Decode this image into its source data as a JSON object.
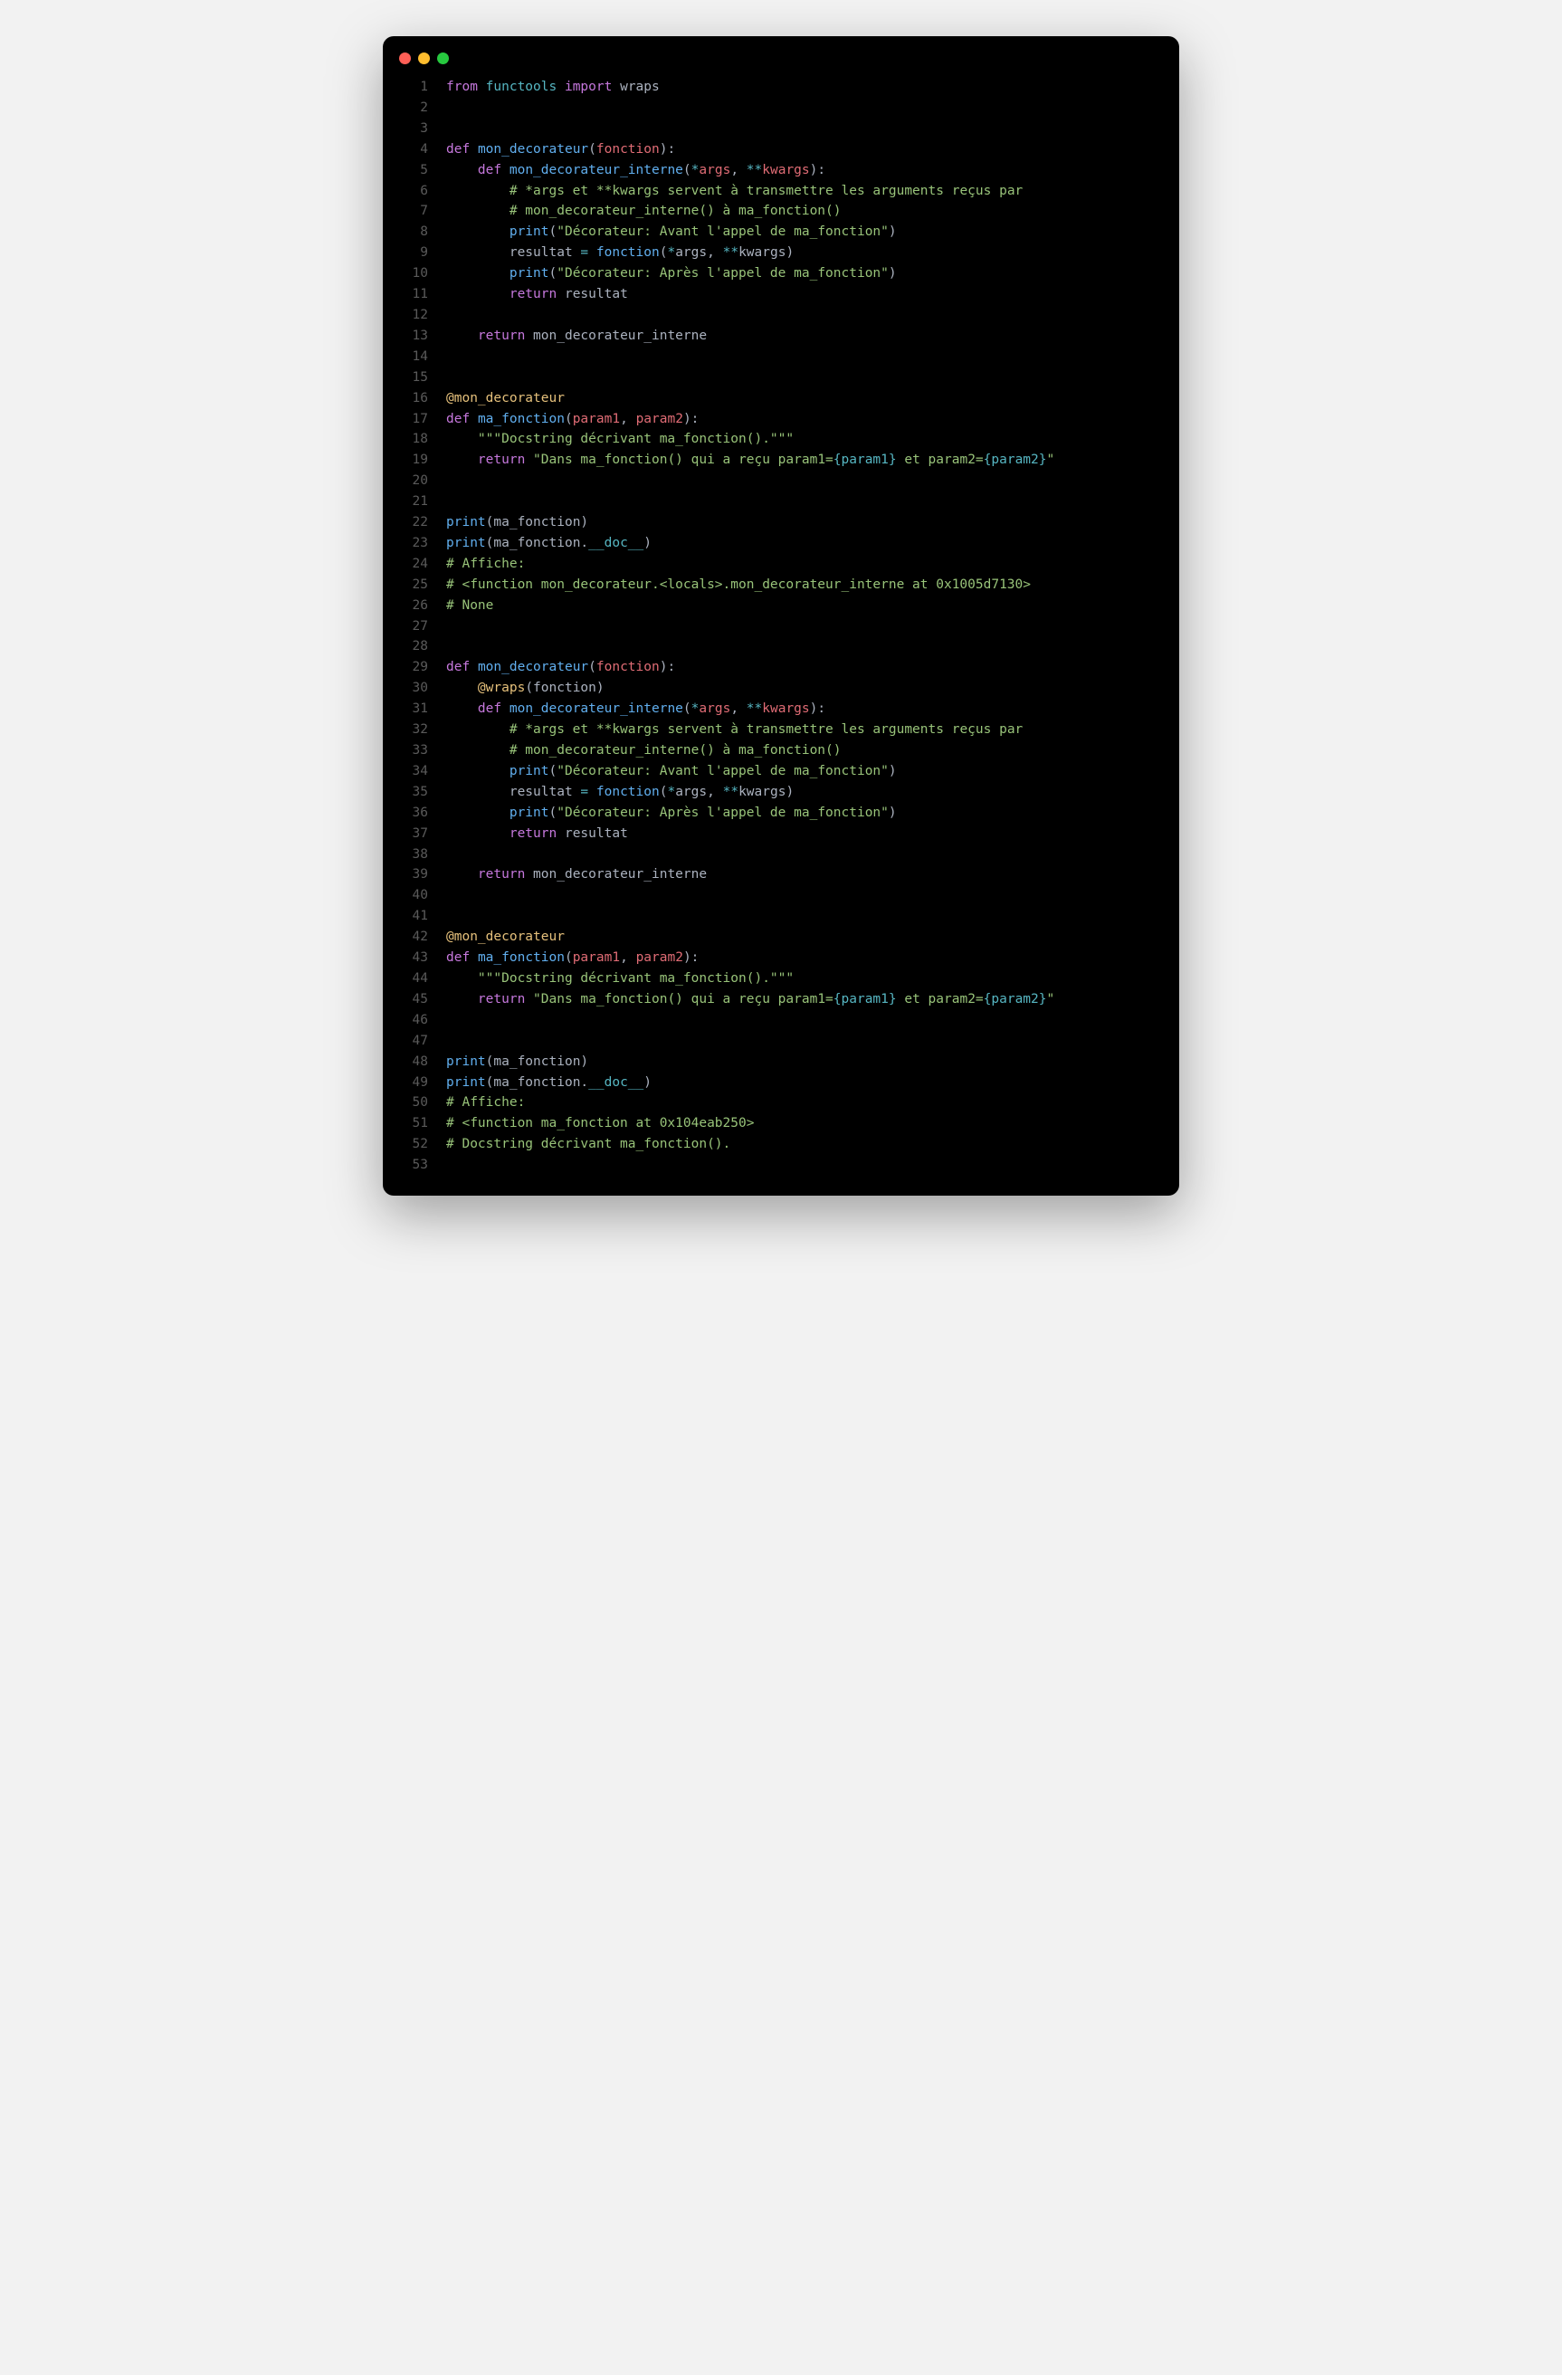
{
  "lines": [
    [
      [
        "kw",
        "from"
      ],
      [
        "p",
        " "
      ],
      [
        "mod",
        "functools"
      ],
      [
        "p",
        " "
      ],
      [
        "kw",
        "import"
      ],
      [
        "p",
        " "
      ],
      [
        "n",
        "wraps"
      ]
    ],
    [],
    [],
    [
      [
        "kw",
        "def"
      ],
      [
        "p",
        " "
      ],
      [
        "fn",
        "mon_decorateur"
      ],
      [
        "p",
        "("
      ],
      [
        "pr",
        "fonction"
      ],
      [
        "p",
        "):"
      ]
    ],
    [
      [
        "p",
        "    "
      ],
      [
        "kw",
        "def"
      ],
      [
        "p",
        " "
      ],
      [
        "fn",
        "mon_decorateur_interne"
      ],
      [
        "p",
        "("
      ],
      [
        "op",
        "*"
      ],
      [
        "pr",
        "args"
      ],
      [
        "p",
        ", "
      ],
      [
        "op",
        "**"
      ],
      [
        "pr",
        "kwargs"
      ],
      [
        "p",
        "):"
      ]
    ],
    [
      [
        "p",
        "        "
      ],
      [
        "cmt",
        "# *args et **kwargs servent à transmettre les arguments reçus par"
      ]
    ],
    [
      [
        "p",
        "        "
      ],
      [
        "cmt",
        "# mon_decorateur_interne() à ma_fonction()"
      ]
    ],
    [
      [
        "p",
        "        "
      ],
      [
        "fn",
        "print"
      ],
      [
        "p",
        "("
      ],
      [
        "s",
        "\"Décorateur: Avant l'appel de ma_fonction\""
      ],
      [
        "p",
        ")"
      ]
    ],
    [
      [
        "p",
        "        "
      ],
      [
        "n",
        "resultat "
      ],
      [
        "op",
        "="
      ],
      [
        "p",
        " "
      ],
      [
        "fn",
        "fonction"
      ],
      [
        "p",
        "("
      ],
      [
        "op",
        "*"
      ],
      [
        "n",
        "args"
      ],
      [
        "p",
        ", "
      ],
      [
        "op",
        "**"
      ],
      [
        "n",
        "kwargs"
      ],
      [
        "p",
        ")"
      ]
    ],
    [
      [
        "p",
        "        "
      ],
      [
        "fn",
        "print"
      ],
      [
        "p",
        "("
      ],
      [
        "s",
        "\"Décorateur: Après l'appel de ma_fonction\""
      ],
      [
        "p",
        ")"
      ]
    ],
    [
      [
        "p",
        "        "
      ],
      [
        "kw",
        "return"
      ],
      [
        "p",
        " "
      ],
      [
        "n",
        "resultat"
      ]
    ],
    [],
    [
      [
        "p",
        "    "
      ],
      [
        "kw",
        "return"
      ],
      [
        "p",
        " "
      ],
      [
        "n",
        "mon_decorateur_interne"
      ]
    ],
    [],
    [],
    [
      [
        "dec",
        "@mon_decorateur"
      ]
    ],
    [
      [
        "kw",
        "def"
      ],
      [
        "p",
        " "
      ],
      [
        "fn",
        "ma_fonction"
      ],
      [
        "p",
        "("
      ],
      [
        "pr",
        "param1"
      ],
      [
        "p",
        ", "
      ],
      [
        "pr",
        "param2"
      ],
      [
        "p",
        "):"
      ]
    ],
    [
      [
        "p",
        "    "
      ],
      [
        "s",
        "\"\"\"Docstring décrivant ma_fonction().\"\"\""
      ]
    ],
    [
      [
        "p",
        "    "
      ],
      [
        "kw",
        "return"
      ],
      [
        "p",
        " "
      ],
      [
        "s",
        "\"Dans ma_fonction() qui a reçu param1="
      ],
      [
        "fs",
        "{param1}"
      ],
      [
        "s",
        " et param2="
      ],
      [
        "fs",
        "{param2}"
      ],
      [
        "s",
        "\""
      ]
    ],
    [],
    [],
    [
      [
        "fn",
        "print"
      ],
      [
        "p",
        "("
      ],
      [
        "n",
        "ma_fonction"
      ],
      [
        "p",
        ")"
      ]
    ],
    [
      [
        "fn",
        "print"
      ],
      [
        "p",
        "("
      ],
      [
        "n",
        "ma_fonction"
      ],
      [
        "p",
        "."
      ],
      [
        "sp",
        "__doc__"
      ],
      [
        "p",
        ")"
      ]
    ],
    [
      [
        "cmt",
        "# Affiche:"
      ]
    ],
    [
      [
        "cmt",
        "# <function mon_decorateur.<locals>.mon_decorateur_interne at 0x1005d7130>"
      ]
    ],
    [
      [
        "cmt",
        "# None"
      ]
    ],
    [],
    [],
    [
      [
        "kw",
        "def"
      ],
      [
        "p",
        " "
      ],
      [
        "fn",
        "mon_decorateur"
      ],
      [
        "p",
        "("
      ],
      [
        "pr",
        "fonction"
      ],
      [
        "p",
        "):"
      ]
    ],
    [
      [
        "p",
        "    "
      ],
      [
        "dec",
        "@wraps"
      ],
      [
        "p",
        "("
      ],
      [
        "n",
        "fonction"
      ],
      [
        "p",
        ")"
      ]
    ],
    [
      [
        "p",
        "    "
      ],
      [
        "kw",
        "def"
      ],
      [
        "p",
        " "
      ],
      [
        "fn",
        "mon_decorateur_interne"
      ],
      [
        "p",
        "("
      ],
      [
        "op",
        "*"
      ],
      [
        "pr",
        "args"
      ],
      [
        "p",
        ", "
      ],
      [
        "op",
        "**"
      ],
      [
        "pr",
        "kwargs"
      ],
      [
        "p",
        "):"
      ]
    ],
    [
      [
        "p",
        "        "
      ],
      [
        "cmt",
        "# *args et **kwargs servent à transmettre les arguments reçus par"
      ]
    ],
    [
      [
        "p",
        "        "
      ],
      [
        "cmt",
        "# mon_decorateur_interne() à ma_fonction()"
      ]
    ],
    [
      [
        "p",
        "        "
      ],
      [
        "fn",
        "print"
      ],
      [
        "p",
        "("
      ],
      [
        "s",
        "\"Décorateur: Avant l'appel de ma_fonction\""
      ],
      [
        "p",
        ")"
      ]
    ],
    [
      [
        "p",
        "        "
      ],
      [
        "n",
        "resultat "
      ],
      [
        "op",
        "="
      ],
      [
        "p",
        " "
      ],
      [
        "fn",
        "fonction"
      ],
      [
        "p",
        "("
      ],
      [
        "op",
        "*"
      ],
      [
        "n",
        "args"
      ],
      [
        "p",
        ", "
      ],
      [
        "op",
        "**"
      ],
      [
        "n",
        "kwargs"
      ],
      [
        "p",
        ")"
      ]
    ],
    [
      [
        "p",
        "        "
      ],
      [
        "fn",
        "print"
      ],
      [
        "p",
        "("
      ],
      [
        "s",
        "\"Décorateur: Après l'appel de ma_fonction\""
      ],
      [
        "p",
        ")"
      ]
    ],
    [
      [
        "p",
        "        "
      ],
      [
        "kw",
        "return"
      ],
      [
        "p",
        " "
      ],
      [
        "n",
        "resultat"
      ]
    ],
    [],
    [
      [
        "p",
        "    "
      ],
      [
        "kw",
        "return"
      ],
      [
        "p",
        " "
      ],
      [
        "n",
        "mon_decorateur_interne"
      ]
    ],
    [],
    [],
    [
      [
        "dec",
        "@mon_decorateur"
      ]
    ],
    [
      [
        "kw",
        "def"
      ],
      [
        "p",
        " "
      ],
      [
        "fn",
        "ma_fonction"
      ],
      [
        "p",
        "("
      ],
      [
        "pr",
        "param1"
      ],
      [
        "p",
        ", "
      ],
      [
        "pr",
        "param2"
      ],
      [
        "p",
        "):"
      ]
    ],
    [
      [
        "p",
        "    "
      ],
      [
        "s",
        "\"\"\"Docstring décrivant ma_fonction().\"\"\""
      ]
    ],
    [
      [
        "p",
        "    "
      ],
      [
        "kw",
        "return"
      ],
      [
        "p",
        " "
      ],
      [
        "s",
        "\"Dans ma_fonction() qui a reçu param1="
      ],
      [
        "fs",
        "{param1}"
      ],
      [
        "s",
        " et param2="
      ],
      [
        "fs",
        "{param2}"
      ],
      [
        "s",
        "\""
      ]
    ],
    [],
    [],
    [
      [
        "fn",
        "print"
      ],
      [
        "p",
        "("
      ],
      [
        "n",
        "ma_fonction"
      ],
      [
        "p",
        ")"
      ]
    ],
    [
      [
        "fn",
        "print"
      ],
      [
        "p",
        "("
      ],
      [
        "n",
        "ma_fonction"
      ],
      [
        "p",
        "."
      ],
      [
        "sp",
        "__doc__"
      ],
      [
        "p",
        ")"
      ]
    ],
    [
      [
        "cmt",
        "# Affiche:"
      ]
    ],
    [
      [
        "cmt",
        "# <function ma_fonction at 0x104eab250>"
      ]
    ],
    [
      [
        "cmt",
        "# Docstring décrivant ma_fonction()."
      ]
    ],
    []
  ]
}
